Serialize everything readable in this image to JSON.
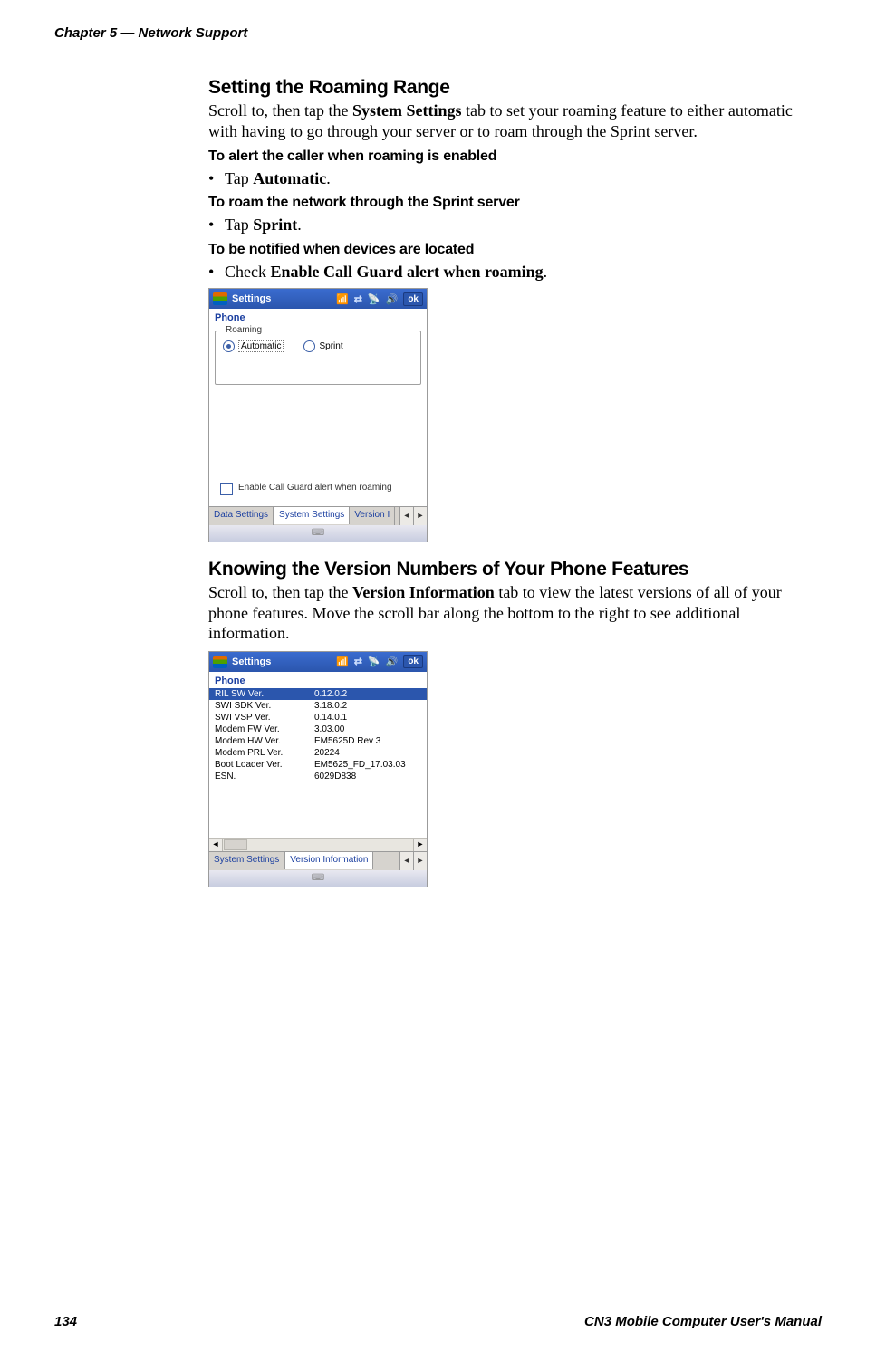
{
  "header": {
    "chapter": "Chapter 5 — Network Support"
  },
  "section1": {
    "title": "Setting the Roaming Range",
    "intro_pre": "Scroll to, then tap the ",
    "intro_bold": "System Settings",
    "intro_post": " tab to set your roaming feature to either automatic with having to go through your server or to roam through the Sprint server.",
    "h1": "To alert the caller when roaming is enabled",
    "b1_pre": "Tap ",
    "b1_bold": "Automatic",
    "b1_post": ".",
    "h2": "To roam the network through the Sprint server",
    "b2_pre": "Tap ",
    "b2_bold": "Sprint",
    "b2_post": ".",
    "h3": "To be notified when devices are located",
    "b3_pre": "Check ",
    "b3_bold": "Enable Call Guard alert when roaming",
    "b3_post": "."
  },
  "screenshot1": {
    "titlebar": "Settings",
    "ok": "ok",
    "subheader": "Phone",
    "fieldset": "Roaming",
    "radio1": "Automatic",
    "radio2": "Sprint",
    "checkbox_label": "Enable Call Guard alert when roaming",
    "tabs": {
      "t1": "Data Settings",
      "t2": "System Settings",
      "t3": "Version I"
    }
  },
  "section2": {
    "title": "Knowing the Version Numbers of Your Phone Features",
    "intro_pre": "Scroll to, then tap the ",
    "intro_bold": "Version Information",
    "intro_post": " tab to view the latest versions of all of your phone features. Move the scroll bar along the bottom to the right to see additional information."
  },
  "screenshot2": {
    "titlebar": "Settings",
    "ok": "ok",
    "subheader": "Phone",
    "rows": [
      {
        "k": "RIL SW Ver.",
        "v": "0.12.0.2"
      },
      {
        "k": "SWI SDK Ver.",
        "v": "3.18.0.2"
      },
      {
        "k": "SWI VSP Ver.",
        "v": "0.14.0.1"
      },
      {
        "k": "Modem FW Ver.",
        "v": "3.03.00"
      },
      {
        "k": "Modem HW Ver.",
        "v": "EM5625D Rev 3"
      },
      {
        "k": "Modem PRL Ver.",
        "v": "20224"
      },
      {
        "k": "Boot Loader Ver.",
        "v": "EM5625_FD_17.03.03"
      },
      {
        "k": "ESN.",
        "v": "6029D838"
      }
    ],
    "tabs": {
      "t1": "System Settings",
      "t2": "Version Information"
    }
  },
  "footer": {
    "page_number": "134",
    "manual": "CN3 Mobile Computer User's Manual"
  }
}
